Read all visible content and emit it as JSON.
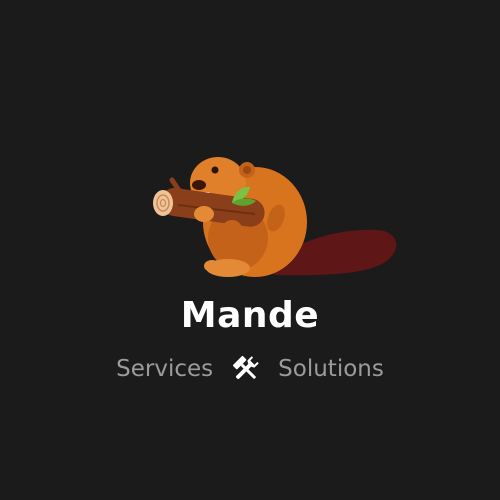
{
  "logo": {
    "mascot_icon": "beaver-holding-log-icon",
    "brand_name": "Mande",
    "tagline": {
      "left_word": "Services",
      "separator_icon": "hammer-wrench-icon",
      "right_word": "Solutions"
    }
  },
  "colors": {
    "background": "#1b1b1b",
    "brand_text": "#ffffff",
    "tagline_text": "#9b9b9b",
    "beaver_fur": "#d9741e",
    "log": "#8a3f1a",
    "tail": "#5e1616",
    "leaf": "#7cc242"
  }
}
